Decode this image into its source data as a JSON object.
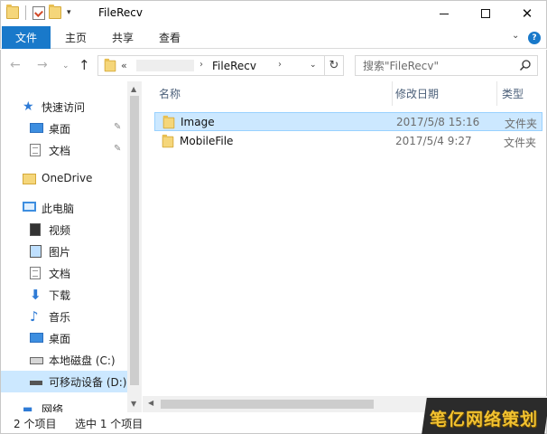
{
  "window": {
    "title": "FileRecv"
  },
  "ribbon": {
    "tabs": [
      "文件",
      "主页",
      "共享",
      "查看"
    ],
    "help": "?"
  },
  "address": {
    "overflow": "«",
    "current": "FileRecv"
  },
  "search": {
    "placeholder": "搜索\"FileRecv\""
  },
  "nav": {
    "quick_access": "快速访问",
    "desktop": "桌面",
    "documents": "文档",
    "onedrive": "OneDrive",
    "this_pc": "此电脑",
    "videos": "视频",
    "pictures": "图片",
    "documents2": "文档",
    "downloads": "下载",
    "music": "音乐",
    "desktop2": "桌面",
    "local_disk": "本地磁盘 (C:)",
    "removable": "可移动设备 (D:)",
    "network": "网络"
  },
  "columns": {
    "name": "名称",
    "date": "修改日期",
    "type": "类型"
  },
  "files": [
    {
      "name": "Image",
      "date": "2017/5/8 15:16",
      "type": "文件夹",
      "selected": true
    },
    {
      "name": "MobileFile",
      "date": "2017/5/4 9:27",
      "type": "文件夹",
      "selected": false
    }
  ],
  "status": {
    "count": "2 个项目",
    "selected": "选中 1 个项目"
  },
  "watermark": "笔亿网络策划",
  "colors": {
    "accent": "#1979ca",
    "selection": "#cce8ff",
    "folder": "#f5d67a"
  }
}
